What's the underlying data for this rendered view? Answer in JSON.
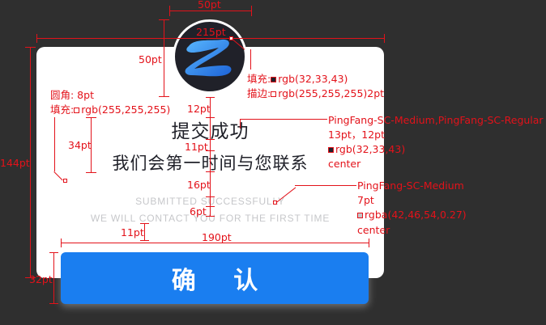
{
  "dialog": {
    "title": "提交成功",
    "subtitle": "我们会第一时间与您联系",
    "en_title": "SUBMITTED SUCCESSFULLY",
    "en_subtitle": "WE WILL CONTACT YOU FOR THE FIRST TIME",
    "confirm_label": "确 认",
    "avatar_icon": "z-logo-icon"
  },
  "annotations": {
    "width_50pt": "50pt",
    "width_215pt": "215pt",
    "height_50pt": "50pt",
    "avatar_fill": "填充:",
    "avatar_fill_value": "rgb(32,33,43)",
    "avatar_stroke": "描边:",
    "avatar_stroke_value": "rgb(255,255,255)2pt",
    "radius": "圆角: 8pt",
    "card_fill": "填充:",
    "card_fill_value": "rgb(255,255,255)",
    "gap_12pt": "12pt",
    "height_34pt": "34pt",
    "height_144pt": "144pt",
    "gap_11pt_a": "11pt",
    "gap_16pt": "16pt",
    "gap_6pt": "6pt",
    "gap_11pt_b": "11pt",
    "width_190pt": "190pt",
    "height_32pt": "32pt",
    "font_cn": "PingFang-SC-Medium,PingFang-SC-Regular",
    "font_cn_size": "13pt，12pt",
    "font_cn_color": "rgb(32,33,43)",
    "font_cn_align": "center",
    "font_en": "PingFang-SC-Medium",
    "font_en_size": "7pt",
    "font_en_color": "rgba(42,46,54,0.27)",
    "font_en_align": "center"
  },
  "colors": {
    "avatar_bg": "#20212b",
    "button_bg": "#1a7ef0",
    "annotation": "#e3121a"
  }
}
